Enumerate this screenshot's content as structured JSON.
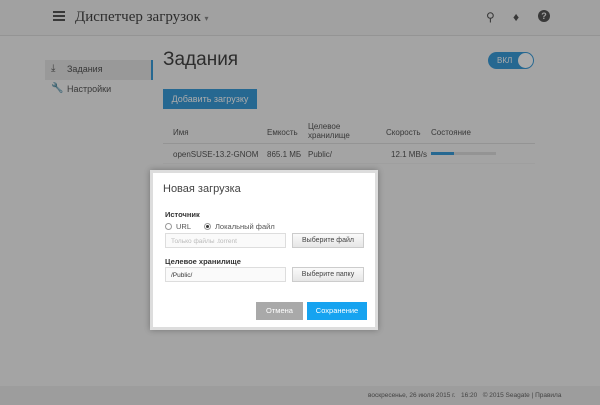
{
  "header": {
    "title": "Диспетчер загрузок",
    "title_caret": "▾"
  },
  "sidebar": {
    "items": [
      {
        "label": "Задания",
        "icon": "download-icon"
      },
      {
        "label": "Настройки",
        "icon": "wrench-icon"
      }
    ]
  },
  "main": {
    "title": "Задания",
    "toggle_label": "ВКЛ",
    "add_button": "Добавить загрузку",
    "columns": [
      "Имя",
      "Емкость",
      "Целевое хранилище",
      "Скорость",
      "Состояние"
    ],
    "rows": [
      {
        "name": "openSUSE-13.2-GNOM",
        "size": "865.1 МБ",
        "target": "Public/",
        "speed": "12.1 MB/s",
        "progress_percent": 35
      }
    ]
  },
  "dialog": {
    "title": "Новая загрузка",
    "source_label": "Источник",
    "radio_url": "URL",
    "radio_local": "Локальный файл",
    "selected": "local",
    "file_placeholder": "Только файлы .torrent",
    "choose_file": "Выберите файл",
    "target_label": "Целевое хранилище",
    "target_value": "/Public/",
    "choose_folder": "Выберите папку",
    "cancel": "Отмена",
    "save": "Сохранение"
  },
  "footer": {
    "date": "воскресенье, 26 июля 2015 г.",
    "time": "16:20",
    "copyright": "© 2015 Seagate | Правила"
  }
}
